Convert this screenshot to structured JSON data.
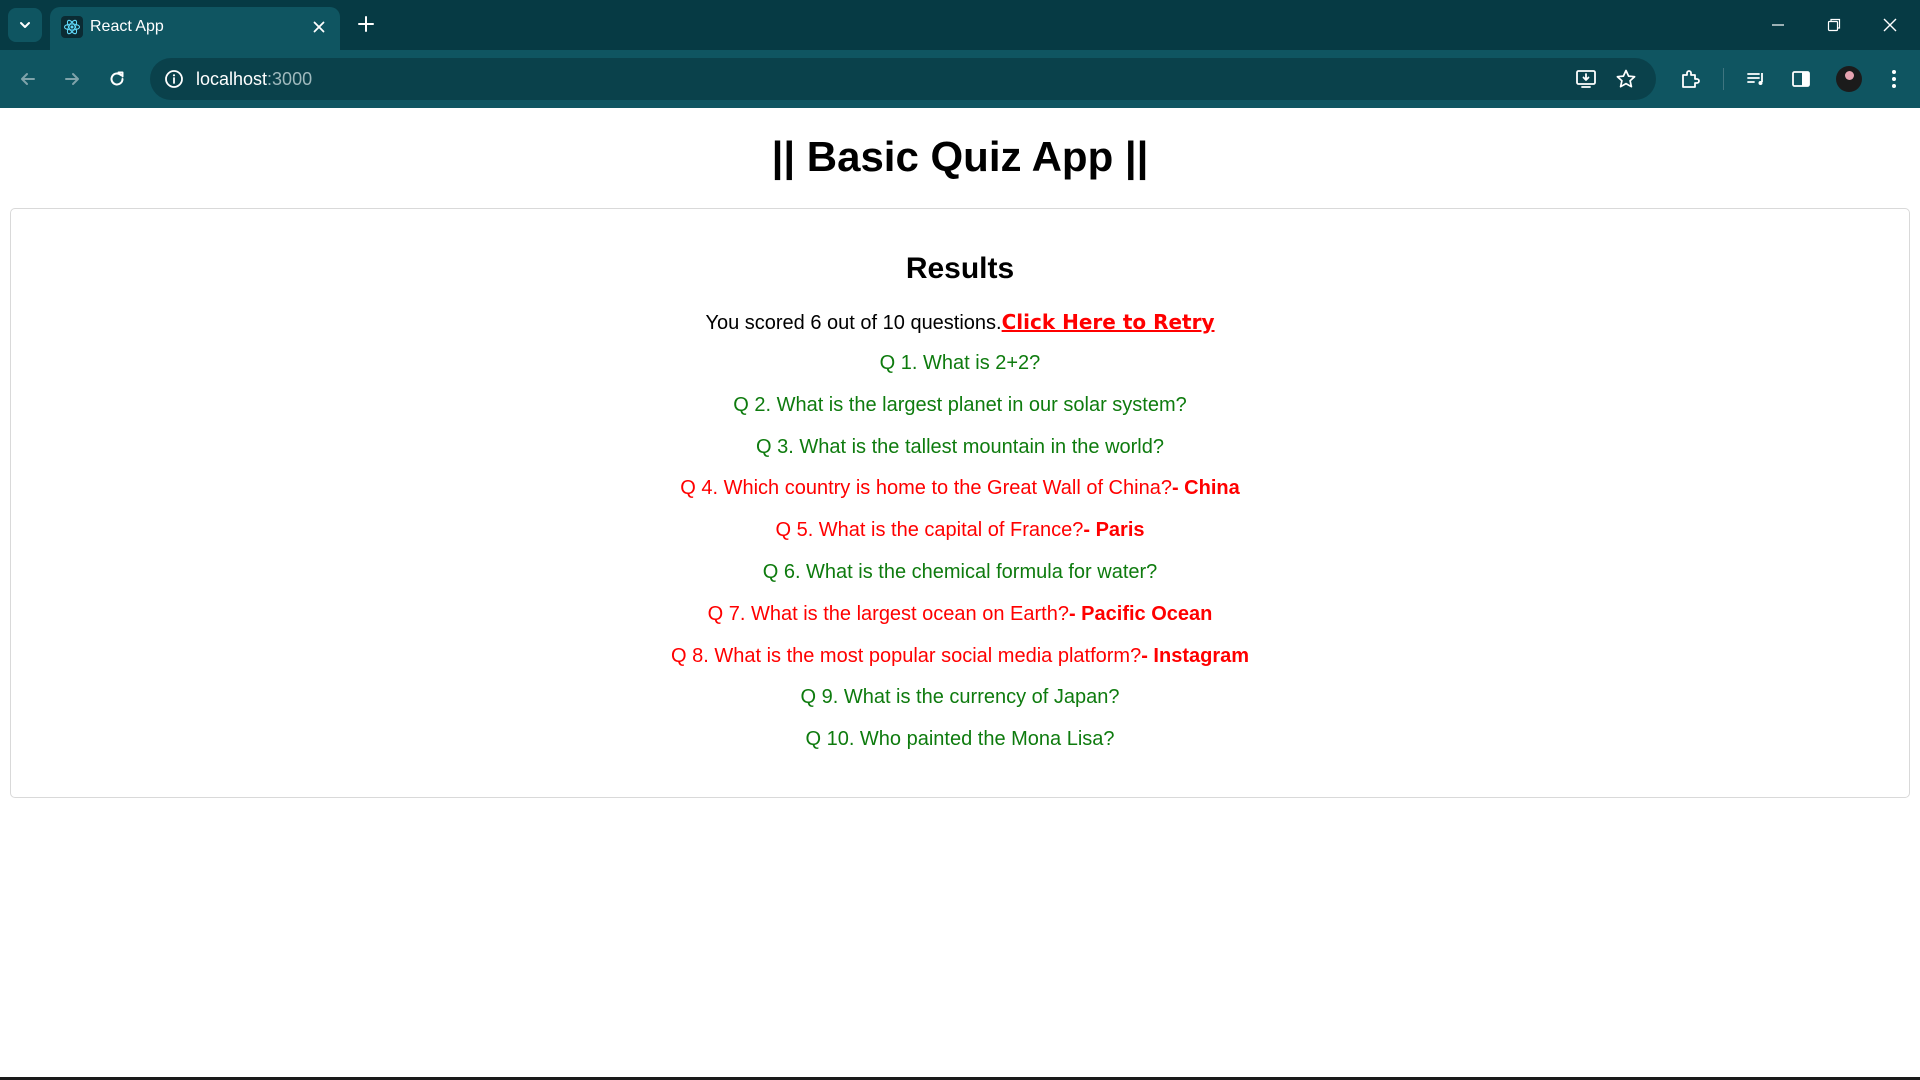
{
  "browser": {
    "tab_title": "React App",
    "url_host": "localhost",
    "url_port": ":3000",
    "theme_color": "#0f5561",
    "frame_color": "#063a44"
  },
  "page": {
    "app_title": "|| Basic Quiz App ||",
    "results_heading": "Results",
    "score_text": "You scored 6 out of 10 questions.",
    "retry_label": "Click Here to Retry",
    "correct_color": "#0e7b0e",
    "wrong_color": "#ff0000",
    "questions": [
      {
        "text": "Q 1. What is 2+2?",
        "status": "correct",
        "answer": ""
      },
      {
        "text": "Q 2. What is the largest planet in our solar system?",
        "status": "correct",
        "answer": ""
      },
      {
        "text": "Q 3. What is the tallest mountain in the world?",
        "status": "correct",
        "answer": ""
      },
      {
        "text": "Q 4. Which country is home to the Great Wall of China?",
        "status": "wrong",
        "answer": "- China"
      },
      {
        "text": "Q 5. What is the capital of France?",
        "status": "wrong",
        "answer": "- Paris"
      },
      {
        "text": "Q 6. What is the chemical formula for water?",
        "status": "correct",
        "answer": ""
      },
      {
        "text": "Q 7. What is the largest ocean on Earth?",
        "status": "wrong",
        "answer": "- Pacific Ocean"
      },
      {
        "text": "Q 8. What is the most popular social media platform?",
        "status": "wrong",
        "answer": "- Instagram"
      },
      {
        "text": "Q 9. What is the currency of Japan?",
        "status": "correct",
        "answer": ""
      },
      {
        "text": "Q 10. Who painted the Mona Lisa?",
        "status": "correct",
        "answer": ""
      }
    ]
  }
}
